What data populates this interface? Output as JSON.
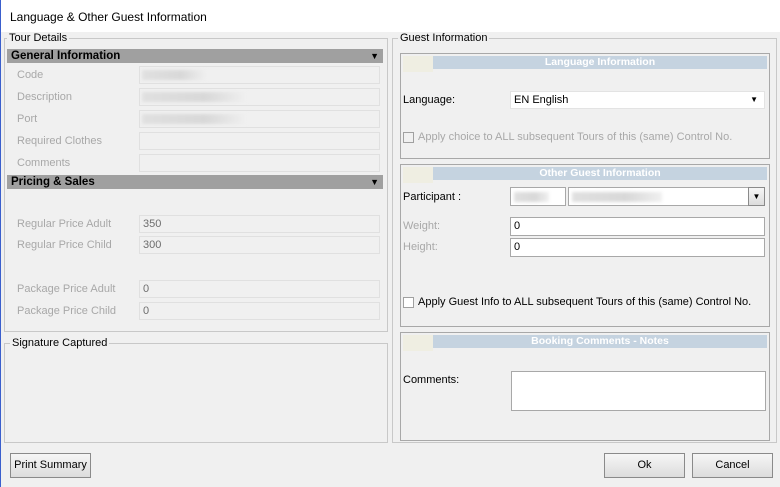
{
  "window": {
    "title": "Language & Other Guest Information"
  },
  "tour_details": {
    "legend": "Tour Details",
    "general": {
      "header": "General Information",
      "fields": [
        {
          "label": "Code",
          "value": ""
        },
        {
          "label": "Description",
          "value": ""
        },
        {
          "label": "Port",
          "value": ""
        },
        {
          "label": "Required Clothes",
          "value": ""
        },
        {
          "label": "Comments",
          "value": ""
        }
      ]
    },
    "pricing": {
      "header": "Pricing & Sales",
      "fields": [
        {
          "label": "Regular Price Adult",
          "value": "350"
        },
        {
          "label": "Regular Price Child",
          "value": "300"
        },
        {
          "label": "Package Price Adult",
          "value": "0"
        },
        {
          "label": "Package Price Child",
          "value": "0"
        }
      ]
    }
  },
  "signature": {
    "legend": "Signature Captured"
  },
  "guest": {
    "legend": "Guest Information",
    "language": {
      "header": "Language Information",
      "label": "Language:",
      "value": "EN  English",
      "apply_label": "Apply choice to ALL subsequent Tours of this (same) Control No."
    },
    "other": {
      "header": "Other Guest Information",
      "participant_label": "Participant :",
      "weight_label": "Weight:",
      "weight_value": "0",
      "height_label": "Height:",
      "height_value": "0",
      "apply_label": "Apply Guest Info to ALL subsequent Tours of this (same) Control No."
    },
    "booking": {
      "header": "Booking Comments - Notes",
      "comments_label": "Comments:",
      "comments_value": ""
    }
  },
  "buttons": {
    "print": "Print Summary",
    "ok": "Ok",
    "cancel": "Cancel"
  }
}
